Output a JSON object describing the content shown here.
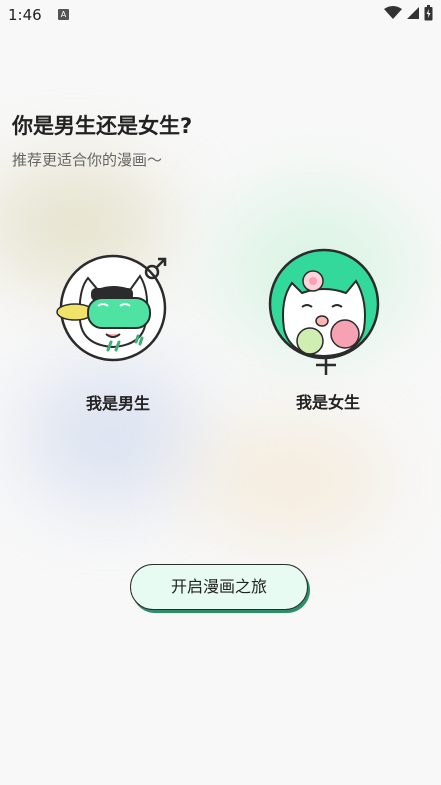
{
  "statusbar": {
    "time": "1:46",
    "notification_glyph": "A"
  },
  "heading": {
    "title": "你是男生还是女生?",
    "subtitle": "推荐更适合你的漫画～"
  },
  "options": [
    {
      "label": "我是男生",
      "icon": "male-symbol-icon",
      "accent": "#4fe3a3"
    },
    {
      "label": "我是女生",
      "icon": "female-symbol-icon",
      "accent": "#33d99a"
    }
  ],
  "start_button": {
    "label": "开启漫画之旅",
    "bg": "#e7fbf2",
    "shadow": "#2a8f6a"
  }
}
